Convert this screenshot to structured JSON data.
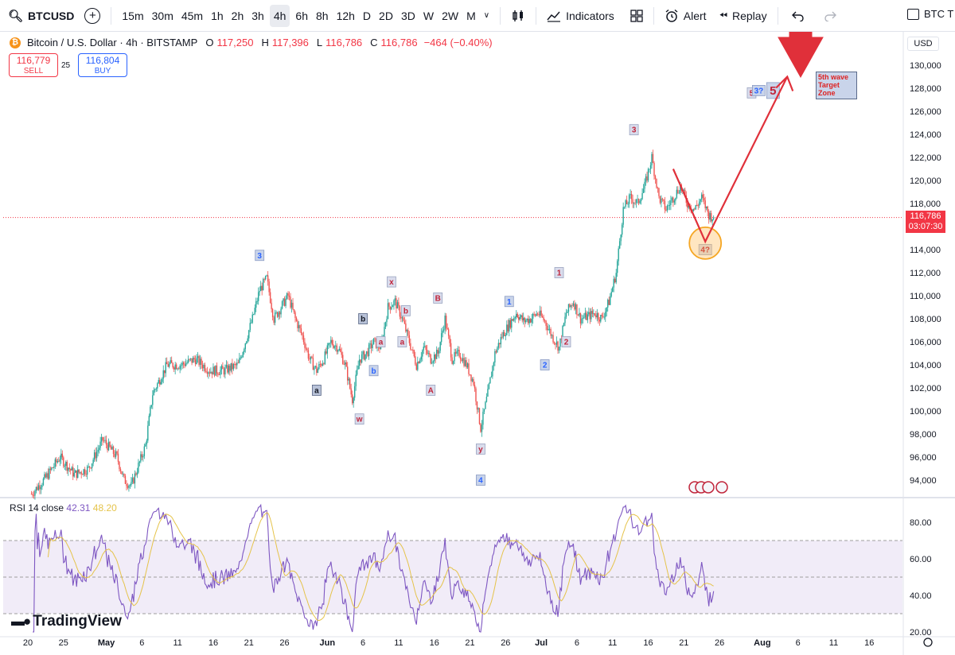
{
  "toolbar": {
    "symbol": "BTCUSD",
    "intervals": [
      "15m",
      "30m",
      "45m",
      "1h",
      "2h",
      "3h",
      "4h",
      "6h",
      "8h",
      "12h",
      "D",
      "2D",
      "3D",
      "W",
      "2W",
      "M"
    ],
    "active_interval": "4h",
    "indicators_label": "Indicators",
    "alert_label": "Alert",
    "replay_label": "Replay",
    "right_label": "BTC T"
  },
  "legend": {
    "title": "Bitcoin / U.S. Dollar · 4h · BITSTAMP",
    "o_label": "O",
    "o": "117,250",
    "h_label": "H",
    "h": "117,396",
    "l_label": "L",
    "l": "116,786",
    "c_label": "C",
    "c": "116,786",
    "change": "−464 (−0.40%)"
  },
  "trade": {
    "sell_price": "116,779",
    "sell_label": "SELL",
    "spread": "25",
    "buy_price": "116,804",
    "buy_label": "BUY"
  },
  "price_axis": {
    "currency": "USD",
    "current_price": "116,786",
    "countdown": "03:07:30"
  },
  "rsi": {
    "label": "RSI 14 close",
    "value": "42.31",
    "ma_value": "48.20"
  },
  "annotation": {
    "target_text": "5th wave Target Zone"
  },
  "brand": {
    "name": "TradingView"
  },
  "colors": {
    "up": "#26a69a",
    "down": "#ef5350",
    "rsi_line": "#7e57c2",
    "rsi_ma": "#e5c34a",
    "rsi_band": "#ede7f6",
    "annotation_red": "#e0303a",
    "current_price_bg": "#f23645"
  },
  "chart_data": {
    "type": "candlestick",
    "title": "Bitcoin / U.S. Dollar · 4h · BITSTAMP",
    "ylim": [
      92500,
      131500
    ],
    "y_ticks": [
      "130,000",
      "128,000",
      "126,000",
      "124,000",
      "122,000",
      "120,000",
      "118,000",
      "116,000",
      "114,000",
      "112,000",
      "110,000",
      "108,000",
      "106,000",
      "104,000",
      "102,000",
      "100,000",
      "98,000",
      "96,000",
      "94,000"
    ],
    "y_tick_values": [
      130000,
      128000,
      126000,
      124000,
      122000,
      120000,
      118000,
      116000,
      114000,
      112000,
      110000,
      108000,
      106000,
      104000,
      102000,
      100000,
      98000,
      96000,
      94000
    ],
    "x_ticks": [
      "20",
      "25",
      "May",
      "6",
      "11",
      "16",
      "21",
      "26",
      "Jun",
      "6",
      "11",
      "16",
      "21",
      "26",
      "Jul",
      "6",
      "11",
      "16",
      "21",
      "26",
      "Aug",
      "6",
      "11",
      "16"
    ],
    "x_tick_days": [
      0,
      5,
      11,
      16,
      21,
      26,
      31,
      36,
      42,
      47,
      52,
      57,
      62,
      67,
      72,
      77,
      82,
      87,
      92,
      97,
      103,
      108,
      113,
      118
    ],
    "price_path": [
      {
        "d": 0.5,
        "p": 92800
      },
      {
        "d": 2.5,
        "p": 94200
      },
      {
        "d": 4.5,
        "p": 96000
      },
      {
        "d": 6.5,
        "p": 94500
      },
      {
        "d": 8.5,
        "p": 95000
      },
      {
        "d": 10.5,
        "p": 97500
      },
      {
        "d": 12.5,
        "p": 96000
      },
      {
        "d": 13.5,
        "p": 94000
      },
      {
        "d": 14.5,
        "p": 93500
      },
      {
        "d": 16.5,
        "p": 97000
      },
      {
        "d": 17.5,
        "p": 101500
      },
      {
        "d": 19.5,
        "p": 104000
      },
      {
        "d": 21.5,
        "p": 104000
      },
      {
        "d": 23.5,
        "p": 104500
      },
      {
        "d": 25.5,
        "p": 103500
      },
      {
        "d": 27.5,
        "p": 103500
      },
      {
        "d": 29.5,
        "p": 104000
      },
      {
        "d": 30.5,
        "p": 106000
      },
      {
        "d": 31.5,
        "p": 108000
      },
      {
        "d": 32.5,
        "p": 110500
      },
      {
        "d": 33.5,
        "p": 111500
      },
      {
        "d": 34.5,
        "p": 108000
      },
      {
        "d": 35.5,
        "p": 109000
      },
      {
        "d": 36.5,
        "p": 110000
      },
      {
        "d": 37.5,
        "p": 108000
      },
      {
        "d": 38.5,
        "p": 106500
      },
      {
        "d": 39.5,
        "p": 104500
      },
      {
        "d": 40.5,
        "p": 103500
      },
      {
        "d": 41.5,
        "p": 104500
      },
      {
        "d": 42.5,
        "p": 106000
      },
      {
        "d": 43.5,
        "p": 105500
      },
      {
        "d": 44.5,
        "p": 104000
      },
      {
        "d": 45.5,
        "p": 101000
      },
      {
        "d": 46.5,
        "p": 104500
      },
      {
        "d": 47.5,
        "p": 105000
      },
      {
        "d": 48.5,
        "p": 106000
      },
      {
        "d": 49.5,
        "p": 105500
      },
      {
        "d": 50.5,
        "p": 109000
      },
      {
        "d": 51.5,
        "p": 109500
      },
      {
        "d": 52.5,
        "p": 108000
      },
      {
        "d": 53.5,
        "p": 106000
      },
      {
        "d": 54.5,
        "p": 104000
      },
      {
        "d": 55.5,
        "p": 105500
      },
      {
        "d": 56.5,
        "p": 104500
      },
      {
        "d": 57.5,
        "p": 105000
      },
      {
        "d": 58.5,
        "p": 108000
      },
      {
        "d": 59.5,
        "p": 104500
      },
      {
        "d": 60.5,
        "p": 105000
      },
      {
        "d": 61.5,
        "p": 104000
      },
      {
        "d": 62.5,
        "p": 102500
      },
      {
        "d": 63.5,
        "p": 98500
      },
      {
        "d": 64.5,
        "p": 101500
      },
      {
        "d": 65.5,
        "p": 105000
      },
      {
        "d": 66.5,
        "p": 106500
      },
      {
        "d": 67.5,
        "p": 107500
      },
      {
        "d": 68.5,
        "p": 108500
      },
      {
        "d": 69.5,
        "p": 107800
      },
      {
        "d": 70.5,
        "p": 108000
      },
      {
        "d": 71.5,
        "p": 108500
      },
      {
        "d": 72.5,
        "p": 107800
      },
      {
        "d": 73.5,
        "p": 106500
      },
      {
        "d": 74.5,
        "p": 105500
      },
      {
        "d": 75.5,
        "p": 108500
      },
      {
        "d": 76.5,
        "p": 109500
      },
      {
        "d": 77.5,
        "p": 108000
      },
      {
        "d": 78.5,
        "p": 108200
      },
      {
        "d": 79.5,
        "p": 108500
      },
      {
        "d": 80.5,
        "p": 108000
      },
      {
        "d": 81.5,
        "p": 109500
      },
      {
        "d": 82.5,
        "p": 112000
      },
      {
        "d": 83.5,
        "p": 117500
      },
      {
        "d": 84.5,
        "p": 118500
      },
      {
        "d": 85.5,
        "p": 118000
      },
      {
        "d": 86.5,
        "p": 119500
      },
      {
        "d": 87.5,
        "p": 122000
      },
      {
        "d": 88.5,
        "p": 118500
      },
      {
        "d": 89.5,
        "p": 117500
      },
      {
        "d": 90.5,
        "p": 118500
      },
      {
        "d": 91.5,
        "p": 119500
      },
      {
        "d": 92.5,
        "p": 118000
      },
      {
        "d": 93.5,
        "p": 117500
      },
      {
        "d": 94.5,
        "p": 118500
      },
      {
        "d": 95.5,
        "p": 117000
      },
      {
        "d": 96.2,
        "p": 116786
      }
    ],
    "current_price": 116786,
    "wave_labels": [
      {
        "text": "3",
        "d": 32.5,
        "p": 113500,
        "style": "blue"
      },
      {
        "text": "a",
        "d": 40.5,
        "p": 101800,
        "style": "dark"
      },
      {
        "text": "b",
        "d": 47.0,
        "p": 108000,
        "style": "dark"
      },
      {
        "text": "w",
        "d": 46.5,
        "p": 99300,
        "style": "red"
      },
      {
        "text": "a",
        "d": 49.5,
        "p": 106000,
        "style": "red"
      },
      {
        "text": "b",
        "d": 48.5,
        "p": 103500,
        "style": "blue"
      },
      {
        "text": "x",
        "d": 51.0,
        "p": 111200,
        "style": "red"
      },
      {
        "text": "b",
        "d": 53.0,
        "p": 108700,
        "style": "red"
      },
      {
        "text": "a",
        "d": 52.5,
        "p": 106000,
        "style": "red"
      },
      {
        "text": "B",
        "d": 57.5,
        "p": 109800,
        "style": "red"
      },
      {
        "text": "A",
        "d": 56.5,
        "p": 101800,
        "style": "red"
      },
      {
        "text": "y",
        "d": 63.5,
        "p": 96700,
        "style": "red"
      },
      {
        "text": "4",
        "d": 63.5,
        "p": 94000,
        "style": "blue"
      },
      {
        "text": "1",
        "d": 67.5,
        "p": 109500,
        "style": "blue"
      },
      {
        "text": "2",
        "d": 72.5,
        "p": 104000,
        "style": "blue"
      },
      {
        "text": "1",
        "d": 74.5,
        "p": 112000,
        "style": "red"
      },
      {
        "text": "2",
        "d": 75.5,
        "p": 106000,
        "style": "red"
      },
      {
        "text": "3",
        "d": 85.0,
        "p": 124400,
        "style": "red"
      },
      {
        "text": "4?",
        "d": 95.0,
        "p": 114000,
        "style": "red"
      },
      {
        "text": "5",
        "d": 101.5,
        "p": 127600,
        "style": "red"
      },
      {
        "text": "3?",
        "d": 102.5,
        "p": 127800,
        "style": "blue"
      },
      {
        "text": "5",
        "d": 104.5,
        "p": 127800,
        "style": "big-red"
      }
    ],
    "projection": [
      {
        "d": 90.5,
        "p": 121000
      },
      {
        "d": 95.0,
        "p": 114700
      },
      {
        "d": 106.5,
        "p": 129000
      }
    ],
    "rsi": {
      "ylim": [
        18,
        92
      ],
      "y_ticks": [
        "80.00",
        "60.00",
        "40.00",
        "20.00"
      ],
      "y_tick_values": [
        80,
        60,
        40,
        20
      ],
      "upper_band": 70,
      "middle_band": 50,
      "lower_band": 30,
      "last_value": 42.31
    }
  }
}
